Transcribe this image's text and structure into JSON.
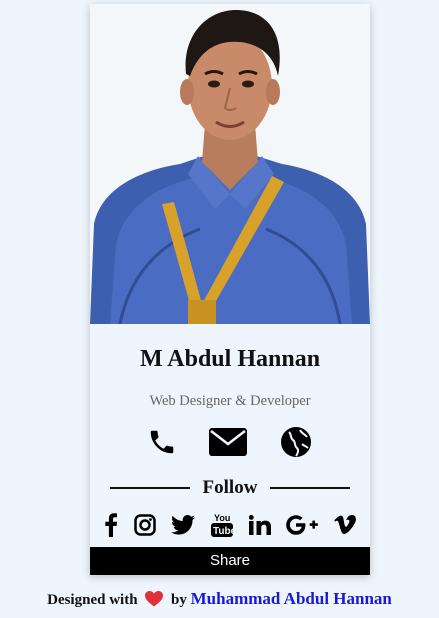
{
  "profile": {
    "name": "M Abdul Hannan",
    "role": "Web Designer & Developer"
  },
  "contact": {
    "icons": [
      "phone-icon",
      "envelope-icon",
      "globe-icon"
    ]
  },
  "follow": {
    "label": "Follow",
    "social_icons": [
      "facebook-icon",
      "instagram-icon",
      "twitter-icon",
      "youtube-icon",
      "linkedin-icon",
      "google-plus-icon",
      "vimeo-icon"
    ]
  },
  "share": {
    "label": "Share"
  },
  "footer": {
    "designed_with": "Designed with",
    "by": "by",
    "author": "Muhammad Abdul Hannan",
    "heart_color": "#e0303a",
    "author_color": "#1a1ad6"
  }
}
